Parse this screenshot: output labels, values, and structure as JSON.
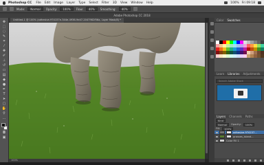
{
  "menubar": {
    "app_name": "Photoshop CC",
    "items": [
      "File",
      "Edit",
      "Image",
      "Layer",
      "Type",
      "Select",
      "Filter",
      "3D",
      "View",
      "Window",
      "Help"
    ],
    "battery": "100%",
    "clock": "Fri 09:18"
  },
  "optbar": {
    "mode_label": "Mode:",
    "mode_value": "Normal",
    "opacity_label": "Opacity:",
    "opacity_value": "100%",
    "flow_label": "Flow:",
    "flow_value": "40%",
    "smoothing_label": "Smoothing:",
    "smoothing_value": "40%"
  },
  "window_title": "Adobe Photoshop CC 2018",
  "document": {
    "tab_title": "Untitled-1 @ 100% (adhesive-974157e-344e-4936-9e47-2047982f56a, Layer Mask/8) *",
    "status": "100%"
  },
  "panels": {
    "top_tabs": [
      "Color",
      "Swatches"
    ],
    "top_active": "Swatches",
    "mid_tabs": [
      "Learn",
      "Libraries",
      "Adjustments"
    ],
    "mid_active": "Libraries",
    "libraries_search_placeholder": "Search Adobe Stock",
    "layer_tabs": [
      "Layers",
      "Channels",
      "Paths"
    ],
    "layer_active": "Layers",
    "kind_label": "Kind",
    "blend_mode": "Normal",
    "opacity_label": "Opacity:",
    "opacity_value": "100%",
    "fill_label": "Fill:",
    "fill_value": "100%",
    "layers": [
      {
        "name": "adhesive-974157...",
        "selected": true
      },
      {
        "name": "grasses_island...",
        "selected": false
      },
      {
        "name": "Color Fill 1",
        "selected": false
      }
    ]
  },
  "swatch_colors": [
    "#ffffff",
    "#000000",
    "#ff0000",
    "#ffff00",
    "#00ff00",
    "#00ffff",
    "#0000ff",
    "#ff00ff",
    "#e0e0e0",
    "#c0c0c0",
    "#a0a0a0",
    "#808080",
    "#606060",
    "#404040",
    "#f4a0a0",
    "#f8c890",
    "#fff4a0",
    "#c8f0a0",
    "#a0e8c0",
    "#a0e0f0",
    "#a0c0f0",
    "#c0a0f0",
    "#f0a0e0",
    "#ff6060",
    "#ff9a40",
    "#ffe040",
    "#90e060",
    "#40d0a0",
    "#e02020",
    "#f07020",
    "#f0c020",
    "#60c030",
    "#20b080",
    "#20a0d0",
    "#2060d0",
    "#6030c0",
    "#c020a0",
    "#b01010",
    "#c05010",
    "#c09000",
    "#409020",
    "#108060",
    "#801010",
    "#804010",
    "#806000",
    "#306010",
    "#105040",
    "#105070",
    "#103080",
    "#401070",
    "#701050",
    "#f0d0b0",
    "#d0a080",
    "#a07050",
    "#704830",
    "#503020",
    "#ffd0d0",
    "#ffe8c0",
    "#fffbd0",
    "#e0ffd0",
    "#d0fff0",
    "#d0f0ff",
    "#d0e0ff",
    "#e8d0ff",
    "#ffd0f0",
    "#c8a070",
    "#b08050",
    "#906040",
    "#705030",
    "#503820"
  ]
}
